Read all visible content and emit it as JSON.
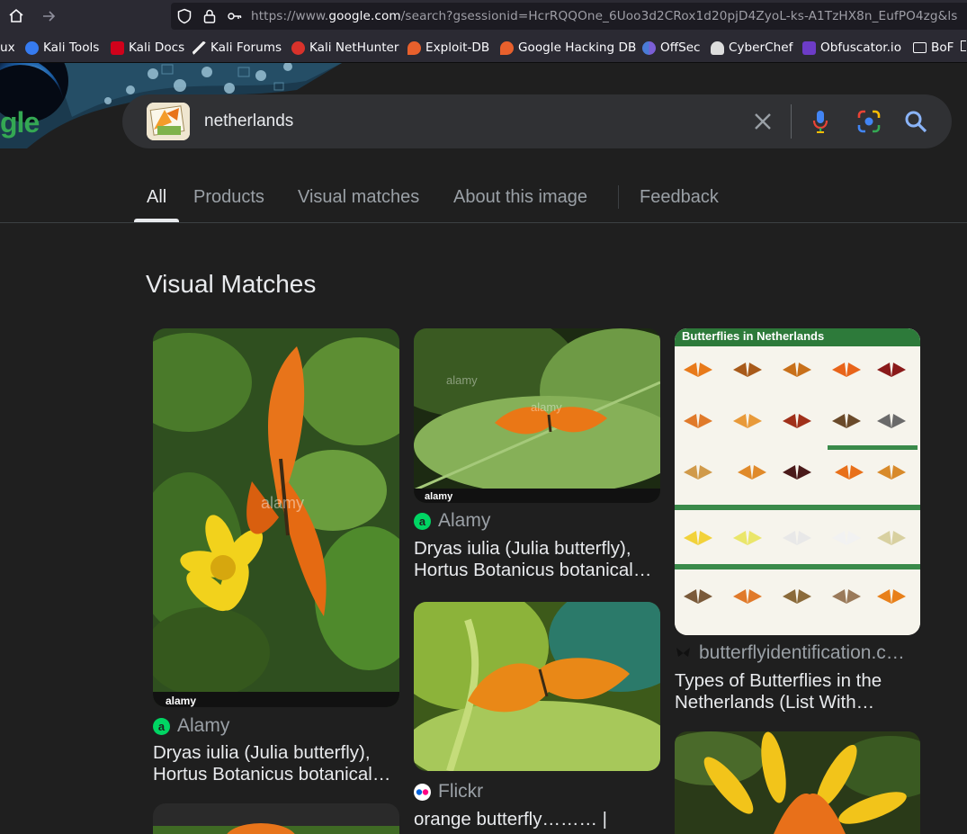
{
  "browser": {
    "url_prefix": "https://www.",
    "url_host": "google.com",
    "url_rest": "/search?gsessionid=HcrRQQOne_6Uoo3d2CRox1d20pjD4ZyoL-ks-A1TzHX8n_EufPO4zg&ls",
    "bookmarks": [
      {
        "label": "ux",
        "color": "#2b2a33"
      },
      {
        "label": "Kali Tools",
        "color": "#367bf0"
      },
      {
        "label": "Kali Docs",
        "color": "#d0021b"
      },
      {
        "label": "Kali Forums",
        "color": "#222222"
      },
      {
        "label": "Kali NetHunter",
        "color": "#d9322b"
      },
      {
        "label": "Exploit-DB",
        "color": "#e8602c"
      },
      {
        "label": "Google Hacking DB",
        "color": "#e8602c"
      },
      {
        "label": "OffSec",
        "color": "#4a7bd6"
      },
      {
        "label": "CyberChef",
        "color": "#dddddd"
      },
      {
        "label": "Obfuscator.io",
        "color": "#6d3cc7"
      },
      {
        "label": "BoF",
        "color": "#2b2a33"
      }
    ]
  },
  "search": {
    "query": "netherlands"
  },
  "tabs": [
    {
      "label": "All"
    },
    {
      "label": "Products"
    },
    {
      "label": "Visual matches"
    },
    {
      "label": "About this image"
    },
    {
      "label": "Feedback"
    }
  ],
  "logo_text": "gle",
  "section_title": "Visual Matches",
  "results": [
    {
      "source": "Alamy",
      "line1": "Dryas iulia (Julia butterfly),",
      "line2": "Hortus Botanicus botanical…"
    },
    {
      "source": "Alamy",
      "line1": "Dryas iulia (Julia butterfly),",
      "line2": "Hortus Botanicus botanical…"
    },
    {
      "source": "Flickr",
      "line1": "orange butterfly……… |",
      "line2": ""
    },
    {
      "source": "butterflyidentification.c…",
      "line1": "Types of Butterflies in the",
      "line2": "Netherlands (List With…"
    }
  ],
  "poster": {
    "title": "Butterflies in Netherlands"
  },
  "watermark": "alamy",
  "colors": {
    "background": "#1f1f1f",
    "search_box": "#303134",
    "alamy_green": "#00d563",
    "butterfly_orange": "#e8741a"
  }
}
